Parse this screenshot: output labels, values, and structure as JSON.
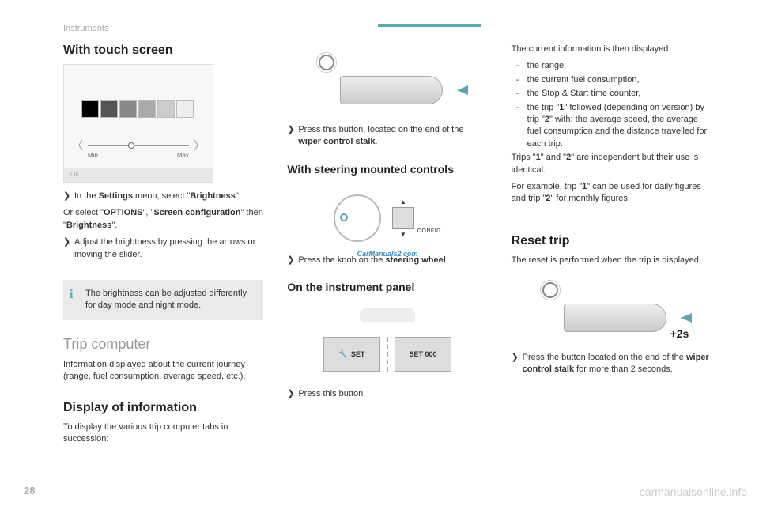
{
  "breadcrumb": "Instruments",
  "page_number": "28",
  "watermark": "carmanualsonline.info",
  "watermark_center": "CarManuals2.com",
  "col1": {
    "h_touch": "With touch screen",
    "slider_min": "Min",
    "slider_max": "Max",
    "slider_ok": "OK",
    "instr1_pre": "In the ",
    "instr1_b1": "Settings",
    "instr1_mid": " menu, select \"",
    "instr1_b2": "Brightness",
    "instr1_end": "\".",
    "instr2_pre": "Or select \"",
    "instr2_b1": "OPTIONS",
    "instr2_mid1": "\", \"",
    "instr2_b2": "Screen configuration",
    "instr2_mid2": "\" then \"",
    "instr2_b3": "Brightness",
    "instr2_end": "\".",
    "instr3": "Adjust the brightness by pressing the arrows or moving the slider.",
    "info": "The brightness can be adjusted differently for day mode and night mode.",
    "h_trip": "Trip computer",
    "trip_desc": "Information displayed about the current journey (range, fuel consumption, average speed, etc.).",
    "h_display": "Display of information",
    "display_desc": "To display the various trip computer tabs in succession:"
  },
  "col2": {
    "stalk_pre": "Press this button, located on the end of the ",
    "stalk_b": "wiper control stalk",
    "stalk_end": ".",
    "h_steer": "With steering mounted controls",
    "config_label": "CONFIG",
    "steer_pre": "Press the knob on the ",
    "steer_b": "steering wheel",
    "steer_end": ".",
    "h_panel": "On the instrument panel",
    "btn_set": "SET",
    "btn_set000": "SET  000",
    "panel_txt": "Press this button."
  },
  "col3": {
    "intro": "The current information is then displayed:",
    "li1": "the range,",
    "li2": "the current fuel consumption,",
    "li3": "the Stop & Start time counter,",
    "li4_pre": "the trip \"",
    "li4_b1": "1",
    "li4_mid1": "\" followed (depending on version) by trip \"",
    "li4_b2": "2",
    "li4_end": "\" with: the average speed, the average fuel consumption and the distance travelled for each trip.",
    "para2_pre": "Trips \"",
    "para2_b1": "1",
    "para2_mid": "\" and \"",
    "para2_b2": "2",
    "para2_end": "\" are independent but their use is identical.",
    "para3_pre": "For example, trip \"",
    "para3_b1": "1",
    "para3_mid": "\" can be used for daily figures and trip \"",
    "para3_b2": "2",
    "para3_end": "\" for monthly figures.",
    "h_reset": "Reset trip",
    "reset_desc": "The reset is performed when the trip is displayed.",
    "twos": "+2s",
    "reset_pre": "Press the button located on the end of the ",
    "reset_b": "wiper control stalk",
    "reset_end": " for more than 2 seconds."
  },
  "marks": {
    "chevron": "❯",
    "dash": "-"
  }
}
